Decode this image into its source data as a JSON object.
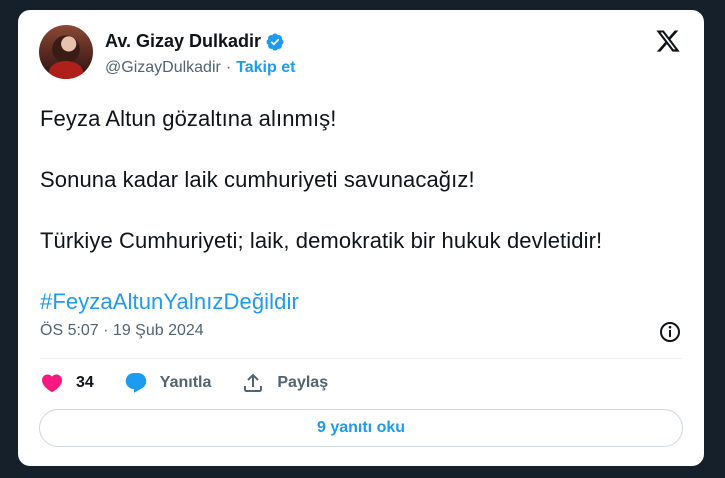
{
  "author": {
    "name": "Av. Gizay Dulkadir",
    "handle": "@GizayDulkadir",
    "separator": "·",
    "follow_label": "Takip et"
  },
  "tweet": {
    "lines": [
      "Feyza Altun gözaltına alınmış!",
      "Sonuna kadar laik cumhuriyeti savunacağız!",
      "Türkiye Cumhuriyeti; laik, demokratik bir hukuk devletidir!"
    ],
    "hashtag": "#FeyzaAltunYalnızDeğildir",
    "timestamp": "ÖS 5:07 · 19 Şub 2024"
  },
  "actions": {
    "like_count": "34",
    "reply_label": "Yanıtla",
    "share_label": "Paylaş"
  },
  "replies_button": "9 yanıtı oku",
  "colors": {
    "background": "#15202b",
    "card": "#ffffff",
    "accent": "#1d9bf0",
    "like": "#f91880"
  },
  "icons": [
    "x-logo-icon",
    "verified-badge-icon",
    "info-icon",
    "heart-icon",
    "reply-icon",
    "share-icon"
  ]
}
